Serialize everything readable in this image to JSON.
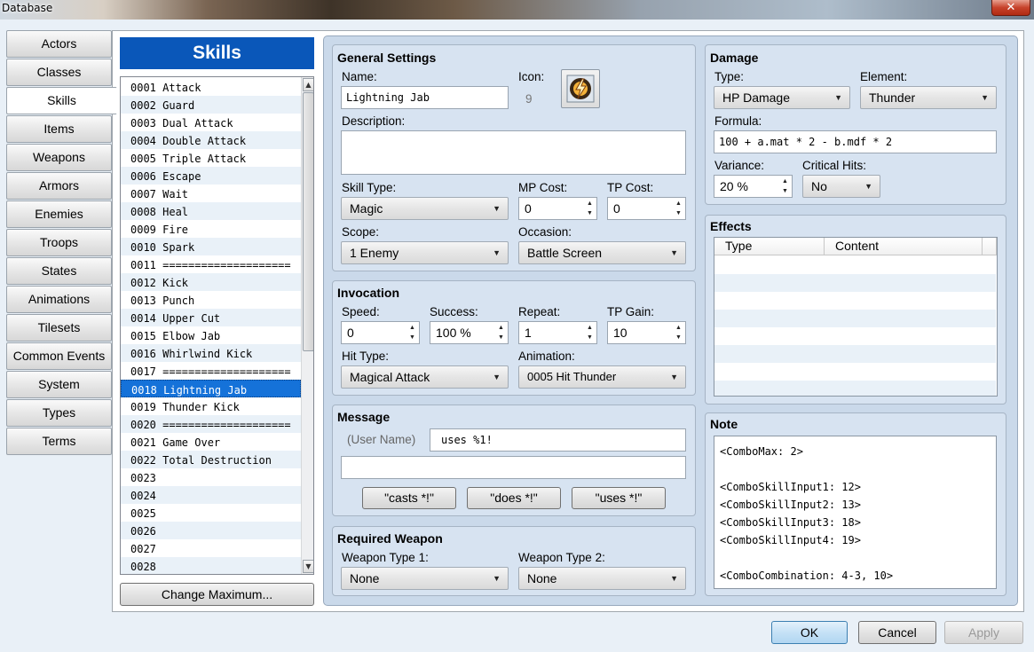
{
  "window": {
    "title": "Database",
    "close": "✕"
  },
  "tabs": [
    "Actors",
    "Classes",
    "Skills",
    "Items",
    "Weapons",
    "Armors",
    "Enemies",
    "Troops",
    "States",
    "Animations",
    "Tilesets",
    "Common Events",
    "System",
    "Types",
    "Terms"
  ],
  "list": {
    "header": "Skills",
    "items": [
      "0001 Attack",
      "0002 Guard",
      "0003 Dual Attack",
      "0004 Double Attack",
      "0005 Triple Attack",
      "0006 Escape",
      "0007 Wait",
      "0008 Heal",
      "0009 Fire",
      "0010 Spark",
      "0011 ====================",
      "0012 Kick",
      "0013 Punch",
      "0014 Upper Cut",
      "0015 Elbow Jab",
      "0016 Whirlwind Kick",
      "0017 ====================",
      "0018 Lightning Jab",
      "0019 Thunder Kick",
      "0020 ====================",
      "0021 Game Over",
      "0022 Total Destruction",
      "0023",
      "0024",
      "0025",
      "0026",
      "0027",
      "0028"
    ],
    "selected_index": 17,
    "change_max": "Change Maximum..."
  },
  "general": {
    "title": "General Settings",
    "name_label": "Name:",
    "name": "Lightning Jab",
    "icon_label": "Icon:",
    "icon_index": "9",
    "desc_label": "Description:",
    "desc": "",
    "skill_type_label": "Skill Type:",
    "skill_type": "Magic",
    "mp_label": "MP Cost:",
    "mp": "0",
    "tp_label": "TP Cost:",
    "tp": "0",
    "scope_label": "Scope:",
    "scope": "1 Enemy",
    "occasion_label": "Occasion:",
    "occasion": "Battle Screen"
  },
  "invocation": {
    "title": "Invocation",
    "speed_label": "Speed:",
    "speed": "0",
    "success_label": "Success:",
    "success": "100 %",
    "repeat_label": "Repeat:",
    "repeat": "1",
    "tpgain_label": "TP Gain:",
    "tpgain": "10",
    "hittype_label": "Hit Type:",
    "hittype": "Magical Attack",
    "anim_label": "Animation:",
    "anim": "0005 Hit Thunder"
  },
  "message": {
    "title": "Message",
    "user_name": "(User Name)",
    "line1": "uses %1!",
    "line2": "",
    "btn_casts": "\"casts *!\"",
    "btn_does": "\"does *!\"",
    "btn_uses": "\"uses *!\""
  },
  "weapon": {
    "title": "Required Weapon",
    "wt1_label": "Weapon Type 1:",
    "wt1": "None",
    "wt2_label": "Weapon Type 2:",
    "wt2": "None"
  },
  "damage": {
    "title": "Damage",
    "type_label": "Type:",
    "type": "HP Damage",
    "element_label": "Element:",
    "element": "Thunder",
    "formula_label": "Formula:",
    "formula": "100 + a.mat * 2 - b.mdf * 2",
    "variance_label": "Variance:",
    "variance": "20 %",
    "crit_label": "Critical Hits:",
    "crit": "No"
  },
  "effects": {
    "title": "Effects",
    "col_type": "Type",
    "col_content": "Content"
  },
  "note": {
    "title": "Note",
    "text": "<ComboMax: 2>\n\n<ComboSkillInput1: 12>\n<ComboSkillInput2: 13>\n<ComboSkillInput3: 18>\n<ComboSkillInput4: 19>\n\n<ComboCombination: 4-3, 10>"
  },
  "footer": {
    "ok": "OK",
    "cancel": "Cancel",
    "apply": "Apply"
  }
}
